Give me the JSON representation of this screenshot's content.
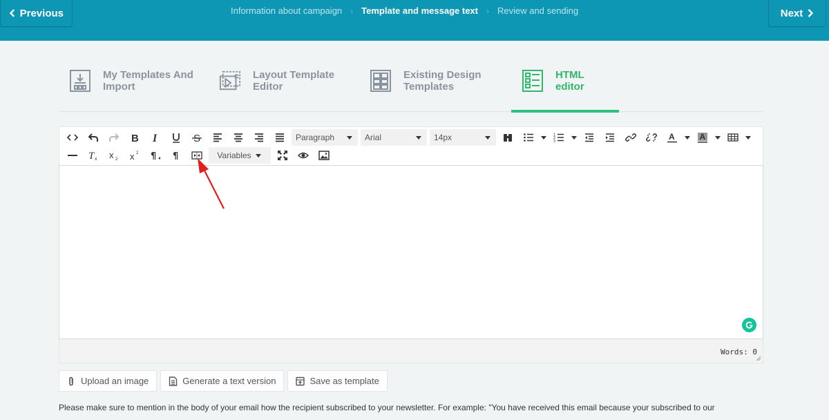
{
  "header": {
    "prev_label": "Previous",
    "next_label": "Next",
    "steps": [
      {
        "label": "Information about campaign",
        "active": false
      },
      {
        "label": "Template and message text",
        "active": true
      },
      {
        "label": "Review and sending",
        "active": false
      }
    ],
    "step_separator": "›",
    "bg_color": "#0e96b5"
  },
  "tabs": [
    {
      "line1": "My Templates And",
      "line2": "Import",
      "icon": "import-icon",
      "active": false
    },
    {
      "line1": "Layout Template",
      "line2": "Editor",
      "icon": "layout-editor-icon",
      "active": false
    },
    {
      "line1": "Existing Design",
      "line2": "Templates",
      "icon": "design-templates-icon",
      "active": false
    },
    {
      "line1": "HTML",
      "line2": "editor",
      "icon": "html-editor-icon",
      "active": true
    }
  ],
  "toolbar": {
    "paragraph": "Paragraph",
    "font": "Arial",
    "size": "14px",
    "variables": "Variables"
  },
  "editor": {
    "words_label": "Words: 0"
  },
  "actions": {
    "upload": "Upload an image",
    "generate": "Generate a text version",
    "save": "Save as template"
  },
  "note": "Please make sure to mention in the body of your email how the recipient subscribed to your newsletter. For example: \"You have received this email because your subscribed to our",
  "colors": {
    "accent_green": "#31c07b",
    "annotation_red": "#e0201a",
    "grammarly": "#15c39a"
  }
}
